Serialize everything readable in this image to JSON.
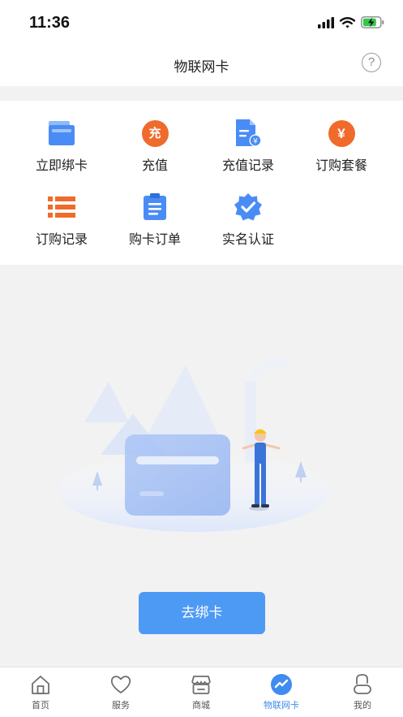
{
  "status_bar": {
    "time": "11:36",
    "icons": [
      "signal-icon",
      "wifi-icon",
      "battery-charging-icon"
    ]
  },
  "header": {
    "title": "物联网卡",
    "help_label": "?"
  },
  "menu": {
    "items": [
      {
        "label": "立即绑卡",
        "icon": "card-stack-icon",
        "color": "#4a8cf5"
      },
      {
        "label": "充值",
        "icon": "recharge-icon",
        "color": "#f06a2c"
      },
      {
        "label": "充值记录",
        "icon": "recharge-record-icon",
        "color": "#4a8cf5"
      },
      {
        "label": "订购套餐",
        "icon": "yuan-icon",
        "color": "#f06a2c"
      },
      {
        "label": "订购记录",
        "icon": "list-icon",
        "color": "#f06a2c"
      },
      {
        "label": "购卡订单",
        "icon": "clipboard-icon",
        "color": "#4a8cf5"
      },
      {
        "label": "实名认证",
        "icon": "verified-badge-icon",
        "color": "#4a8cf5"
      }
    ],
    "recharge_glyph": "充",
    "yuan_glyph": "¥"
  },
  "action": {
    "bind_label": "去绑卡"
  },
  "tabs": [
    {
      "label": "首页",
      "icon": "home-icon",
      "active": false
    },
    {
      "label": "服务",
      "icon": "heart-icon",
      "active": false
    },
    {
      "label": "商城",
      "icon": "store-icon",
      "active": false
    },
    {
      "label": "物联网卡",
      "icon": "iot-card-icon",
      "active": true
    },
    {
      "label": "我的",
      "icon": "profile-icon",
      "active": false
    }
  ],
  "colors": {
    "accent": "#4d9af5",
    "orange": "#f06a2c",
    "active_tab": "#3f8bf0"
  }
}
